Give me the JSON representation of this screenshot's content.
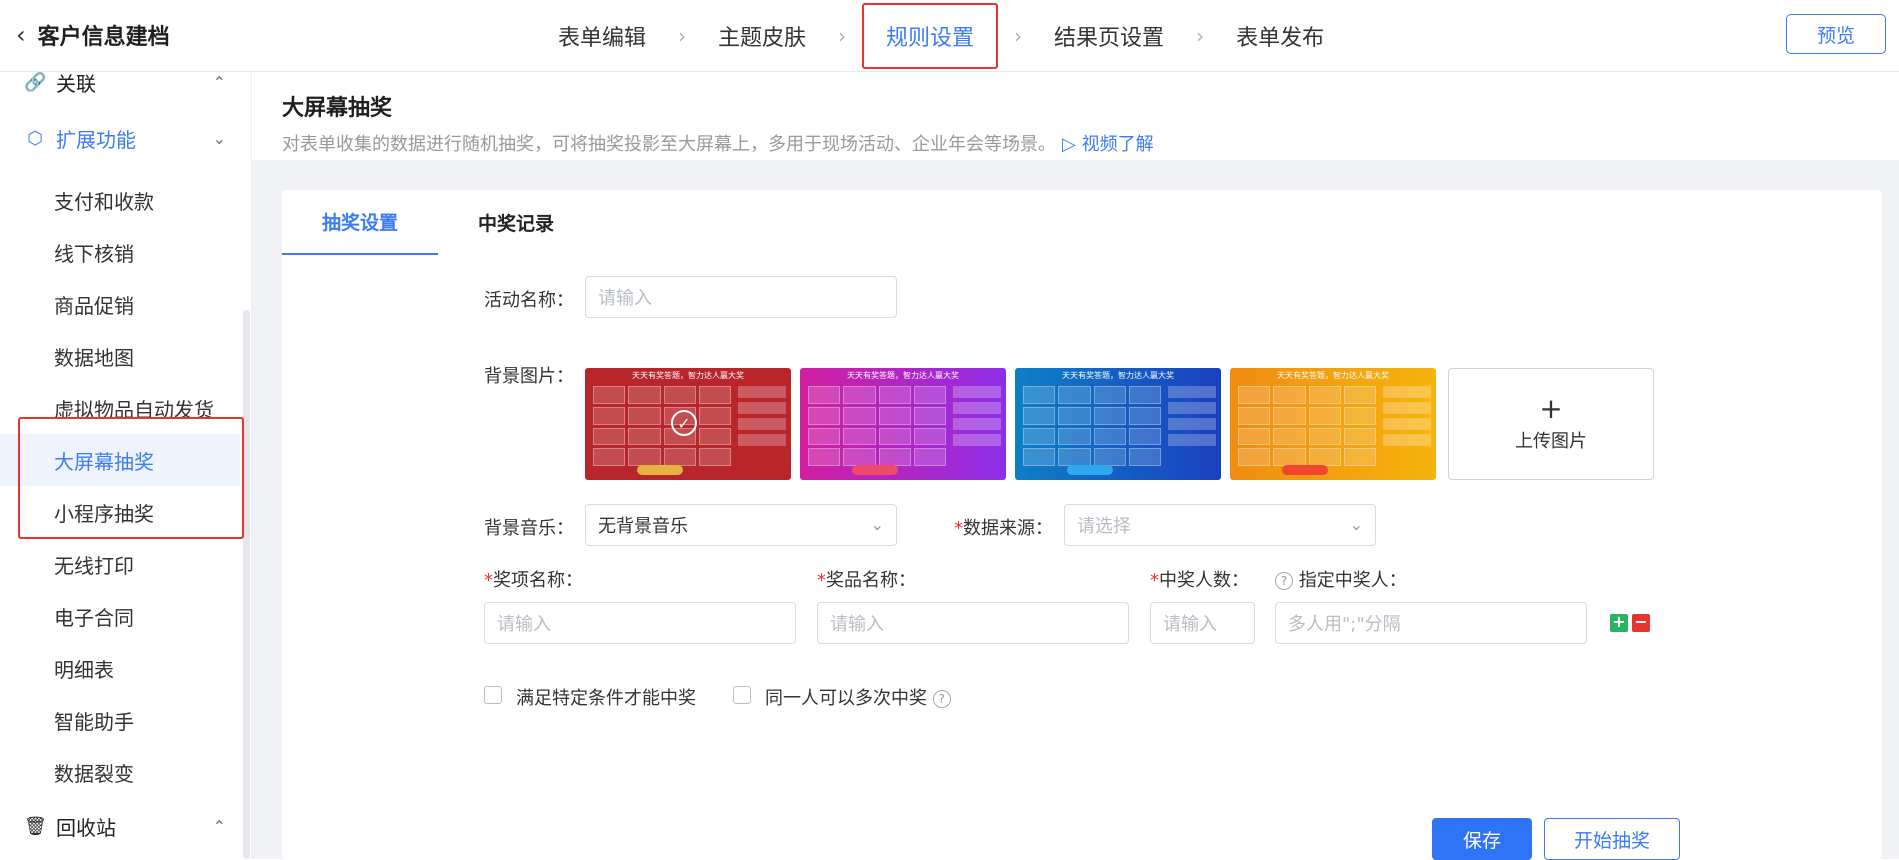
{
  "header": {
    "back_title": "客户信息建档",
    "steps": [
      "表单编辑",
      "主题皮肤",
      "规则设置",
      "结果页设置",
      "表单发布"
    ],
    "active_step": "规则设置",
    "preview_label": "预览"
  },
  "sidebar": {
    "group_link": "关联",
    "group_ext": "扩展功能",
    "items": [
      "支付和收款",
      "线下核销",
      "商品促销",
      "数据地图",
      "虚拟物品自动发货",
      "大屏幕抽奖",
      "小程序抽奖",
      "无线打印",
      "电子合同",
      "明细表",
      "智能助手",
      "数据裂变"
    ],
    "active_item": "大屏幕抽奖",
    "group_trash": "回收站"
  },
  "page": {
    "title": "大屏幕抽奖",
    "description": "对表单收集的数据进行随机抽奖，可将抽奖投影至大屏幕上，多用于现场活动、企业年会等场景。",
    "video_link": "视频了解"
  },
  "tabs": [
    "抽奖设置",
    "中奖记录"
  ],
  "form": {
    "activity_name_label": "活动名称：",
    "activity_name_placeholder": "请输入",
    "bg_image_label": "背景图片：",
    "thumb_title": "天天有奖答题，智力达人赢大奖",
    "thumb_colors": [
      "#b8262c",
      "#c41ec8",
      "#1257c8",
      "#f2a20f"
    ],
    "upload_label": "上传图片",
    "bg_music_label": "背景音乐：",
    "bg_music_value": "无背景音乐",
    "data_source_label": "数据来源：",
    "data_source_placeholder": "请选择",
    "prize_item_label": "奖项名称：",
    "prize_name_label": "奖品名称：",
    "winner_count_label": "中奖人数：",
    "assigned_winner_label": "指定中奖人：",
    "input_placeholder": "请输入",
    "assigned_placeholder": "多人用\";\"分隔",
    "checkbox_condition": "满足特定条件才能中奖",
    "checkbox_multi": "同一人可以多次中奖",
    "save_label": "保存",
    "start_label": "开始抽奖"
  }
}
